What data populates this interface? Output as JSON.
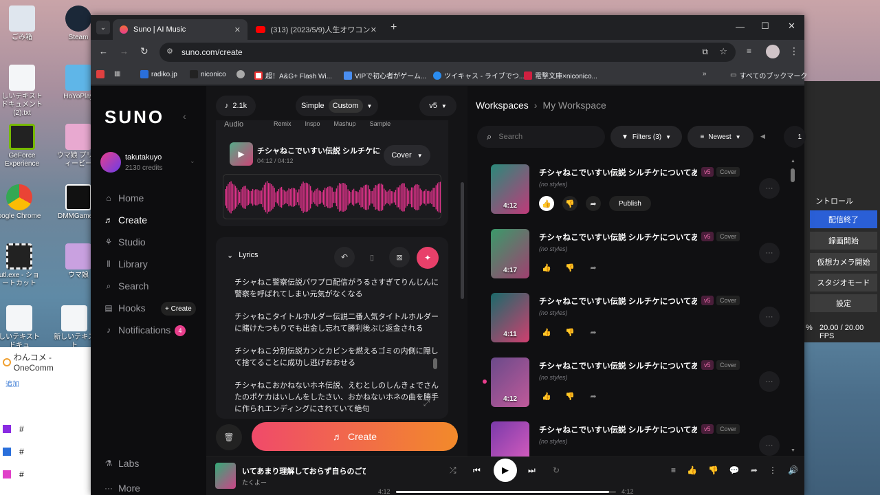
{
  "desktop": {
    "icons": [
      {
        "label": "ごみ箱",
        "name": "recycle-bin-icon"
      },
      {
        "label": "Steam",
        "name": "steam-icon"
      },
      {
        "label": "しいテキスト ドキュメント (2).txt",
        "name": "text-file-icon"
      },
      {
        "label": "HoYoPlay",
        "name": "hoyoplay-icon"
      },
      {
        "label": "GeForce Experience",
        "name": "geforce-icon"
      },
      {
        "label": "ウマ娘 プリティービー",
        "name": "umamusume-icon"
      },
      {
        "label": "oogle Chrome",
        "name": "chrome-icon"
      },
      {
        "label": "DMMGamePl",
        "name": "dmm-icon"
      },
      {
        "label": "utl.exe - ショートカット",
        "name": "shortcut-icon"
      },
      {
        "label": "ウマ娘",
        "name": "umamusume2-icon"
      },
      {
        "label": "しいテキスト ドキュ",
        "name": "text-file2-icon"
      },
      {
        "label": "新しいテキスト",
        "name": "text-file3-icon"
      }
    ],
    "side_app": {
      "title": "わんコメ - OneComm",
      "add": "追加",
      "rows": [
        "#",
        "#",
        "#"
      ]
    },
    "obs": {
      "control": "ントロール",
      "buttons": [
        "配信終了",
        "録画開始",
        "仮想カメラ開始",
        "スタジオモード",
        "設定"
      ],
      "fps": "20.00 / 20.00 FPS",
      "pct": "%"
    }
  },
  "browser": {
    "tabs": [
      {
        "title": "Suno | AI Music"
      },
      {
        "title": "(313) (2023/5/9)人生オワコン会"
      }
    ],
    "url": "suno.com/create",
    "bookmarks": [
      "radiko.jp",
      "niconico",
      "",
      "超！A&G+ Flash Wi...",
      "VIPで初心者がゲーム...",
      "ツイキャス - ライブでつ...",
      "電撃文庫×niconico..."
    ],
    "bookmark_folder": "すべてのブックマーク"
  },
  "suno": {
    "logo": "SUNO",
    "user": {
      "name": "takutakuyo",
      "credits": "2130 credits"
    },
    "nav": [
      {
        "label": "Home",
        "icon": "home-icon"
      },
      {
        "label": "Create",
        "icon": "create-icon"
      },
      {
        "label": "Studio",
        "icon": "studio-icon"
      },
      {
        "label": "Library",
        "icon": "library-icon"
      },
      {
        "label": "Search",
        "icon": "search-icon"
      },
      {
        "label": "Hooks",
        "icon": "hooks-icon"
      },
      {
        "label": "Notifications",
        "icon": "bell-icon"
      }
    ],
    "hooks_create": "+ Create",
    "notif_count": "4",
    "labs": "Labs",
    "more": "More",
    "create_panel": {
      "count": "2.1k",
      "simple": "Simple",
      "custom": "Custom",
      "version": "v5",
      "audio_label": "Audio",
      "audio_tabs": [
        "Remix",
        "Inspo",
        "Mashup",
        "Sample"
      ],
      "audio_title": "チシャねこでいすい伝説 シルチケにつ...",
      "audio_time": "04:12 / 04:12",
      "cover": "Cover",
      "lyrics_label": "Lyrics",
      "lyrics": [
        "チシャねこ警察伝説パワプロ配信がうるさすぎてりんじんに警察を呼ばれてしまい元気がなくなる",
        "チシャねこタイトルホルダー伝説二番人気タイトルホルダーに賭けたつもりでも出金し忘れて勝利後ぶじ返金される",
        "チシャねこ分別伝説カンとカビンを燃えるゴミの内側に隠して捨てることに成功し逃げおおせる",
        "チシャねこおかねないホネ伝説、えむとしのしんきょでさんたのポケカはいしんをしたさい、おかねないホネの曲を勝手に作られエンディングにされていて絶句"
      ],
      "create_btn": "Create"
    },
    "workspace": {
      "root": "Workspaces",
      "current": "My Workspace",
      "search_placeholder": "Search",
      "filters": "Filters (3)",
      "sort": "Newest",
      "page": "1"
    },
    "songs": [
      {
        "title": "チシャねこでいすい伝説 シルチケについてあまり...",
        "style": "(no styles)",
        "duration": "4:12",
        "badge": "v5",
        "tag": "Cover",
        "publish": "Publish"
      },
      {
        "title": "チシャねこでいすい伝説 シルチケについてあまり...",
        "style": "(no styles)",
        "duration": "4:17",
        "badge": "v5",
        "tag": "Cover"
      },
      {
        "title": "チシャねこでいすい伝説 シルチケについてあまり...",
        "style": "(no styles)",
        "duration": "4:11",
        "badge": "v5",
        "tag": "Cover"
      },
      {
        "title": "チシャねこでいすい伝説 シルチケについてあまり...",
        "style": "(no styles)",
        "duration": "4:12",
        "badge": "v5",
        "tag": "Cover"
      },
      {
        "title": "チシャねこでいすい伝説 シルチケについてあまり...",
        "style": "(no styles)",
        "duration": "",
        "badge": "v5",
        "tag": "Cover"
      }
    ],
    "player": {
      "title": "いてあまり理解しておらず自らのごひゃく",
      "artist": "たくよー",
      "elapsed": "4:12",
      "total": "4:12",
      "progress": 0.97
    }
  },
  "colors": {
    "accent": "#e83e8c",
    "create_grad_start": "#f04a6a",
    "create_grad_end": "#f28a2a"
  }
}
